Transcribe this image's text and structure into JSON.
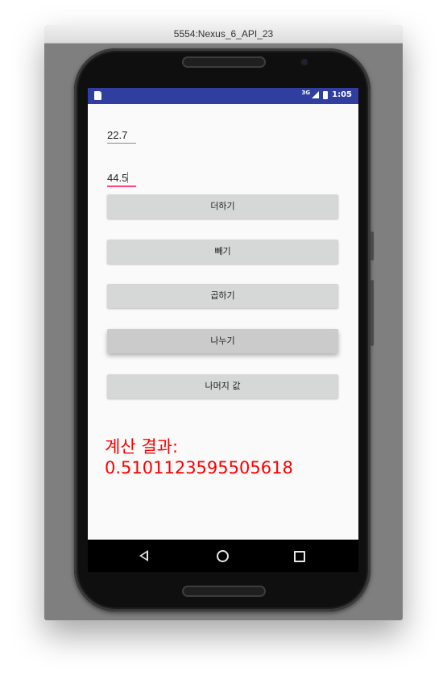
{
  "window": {
    "title": "5554:Nexus_6_API_23"
  },
  "status_bar": {
    "network": "3G",
    "time": "1:05"
  },
  "app": {
    "input1": {
      "value": "22.7"
    },
    "input2": {
      "value": "44.5"
    },
    "buttons": [
      {
        "label": "더하기"
      },
      {
        "label": "빼기"
      },
      {
        "label": "곱하기"
      },
      {
        "label": "나누기"
      },
      {
        "label": "나머지 값"
      }
    ],
    "result": {
      "label": "계산 결과:",
      "value": "0.5101123595505618"
    },
    "colors": {
      "result": "#ff0000",
      "status_bar": "#303f9f",
      "accent": "#ff4081"
    }
  },
  "nav_bar": {
    "icons": [
      "back-icon",
      "home-icon",
      "recents-icon"
    ]
  }
}
